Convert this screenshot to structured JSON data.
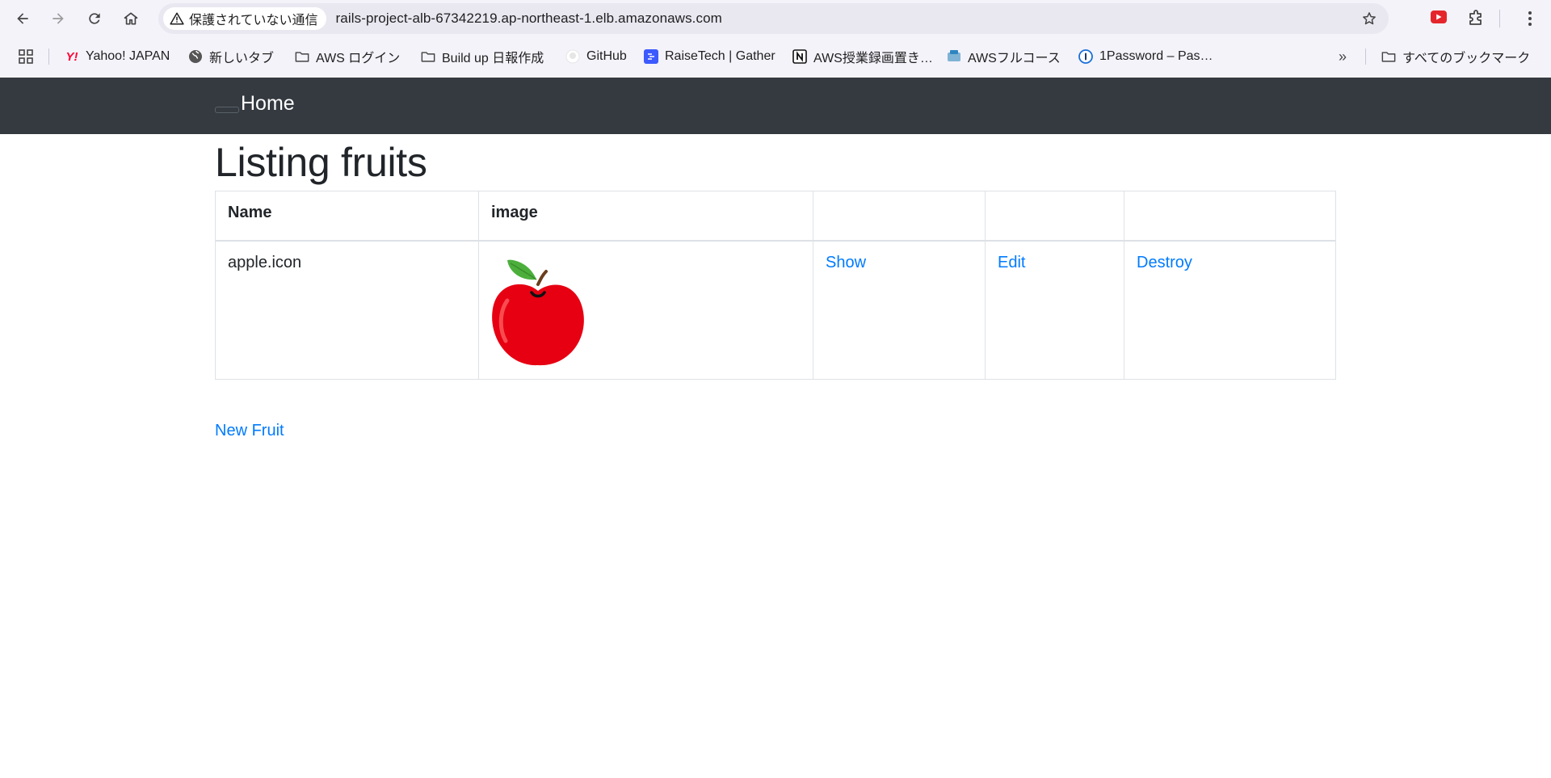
{
  "browser": {
    "security_label": "保護されていない通信",
    "url": "rails-project-alb-67342219.ap-northeast-1.elb.amazonaws.com",
    "bookmarks": [
      {
        "label": "Yahoo! JAPAN",
        "icon": "yahoo-icon"
      },
      {
        "label": "新しいタブ",
        "icon": "globe-icon"
      },
      {
        "label": "AWS ログイン",
        "icon": "folder-icon"
      },
      {
        "label": "Build up 日報作成",
        "icon": "folder-icon"
      },
      {
        "label": "GitHub",
        "icon": "github-icon"
      },
      {
        "label": "RaiseTech | Gather",
        "icon": "gather-icon"
      },
      {
        "label": "AWS授業録画置き…",
        "icon": "notion-icon"
      },
      {
        "label": "AWSフルコース",
        "icon": "aws-course-icon"
      },
      {
        "label": "1Password – Pas…",
        "icon": "1password-icon"
      }
    ],
    "all_bookmarks_label": "すべてのブックマーク"
  },
  "navbar": {
    "brand": "Home"
  },
  "page": {
    "title": "Listing fruits",
    "table": {
      "headers": [
        "Name",
        "image",
        "",
        "",
        ""
      ],
      "rows": [
        {
          "name": "apple.icon",
          "image_icon": "apple-icon",
          "show": "Show",
          "edit": "Edit",
          "destroy": "Destroy"
        }
      ]
    },
    "new_link": "New Fruit"
  },
  "colors": {
    "navbar_bg": "#343a40",
    "link": "#007bff",
    "text": "#212529",
    "apple_red": "#e60012",
    "leaf_green": "#4caf3c"
  }
}
